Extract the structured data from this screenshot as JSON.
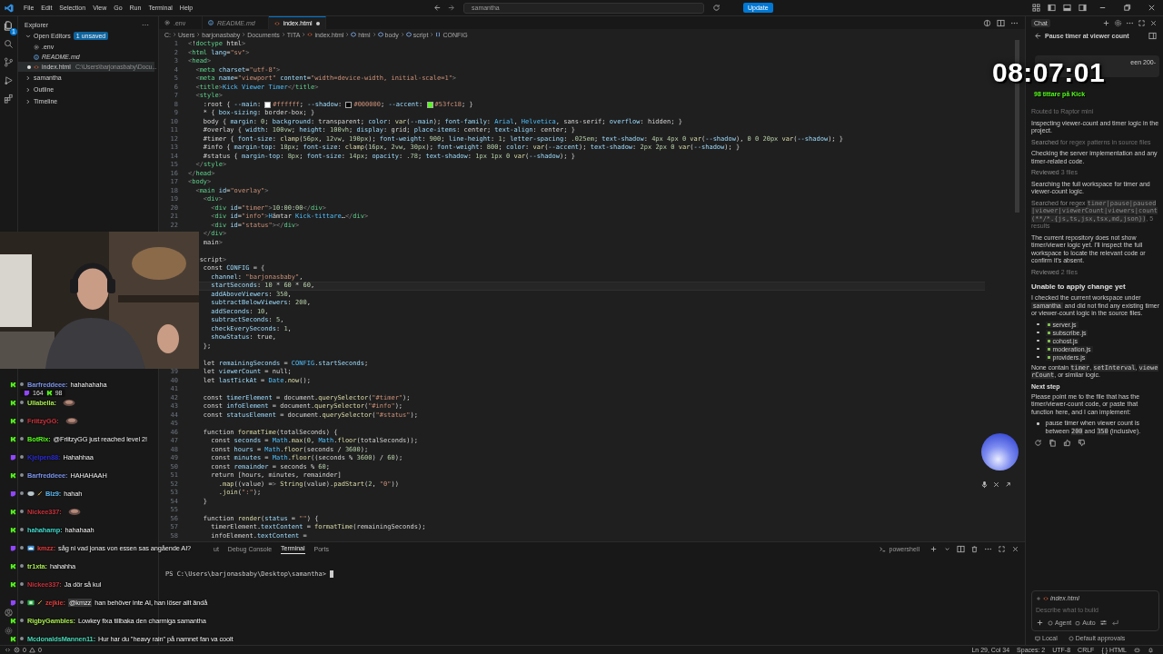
{
  "titlebar": {
    "menu": [
      "File",
      "Edit",
      "Selection",
      "View",
      "Go",
      "Run",
      "Terminal",
      "Help"
    ],
    "search": "samantha",
    "update_button": "Update"
  },
  "activity_bar": {
    "explorer_badge": "1"
  },
  "explorer": {
    "title": "Explorer",
    "open_editors": {
      "label": "Open Editors",
      "badge": "1 unsaved",
      "expanded": true,
      "items": [
        {
          "name": ".env",
          "kind": "settings",
          "preview": false,
          "selected": false,
          "modified": false
        },
        {
          "name": "README.md",
          "kind": "markdown",
          "preview": true,
          "selected": false,
          "modified": false
        },
        {
          "name": "index.html",
          "path": "C:\\Users\\barjonasbaby\\Docu...",
          "kind": "html",
          "preview": false,
          "selected": true,
          "modified": true
        }
      ]
    },
    "sections": [
      {
        "label": "samantha",
        "expanded": false
      },
      {
        "label": "Outline",
        "expanded": false
      },
      {
        "label": "Timeline",
        "expanded": false
      }
    ]
  },
  "tabs": [
    {
      "label": ".env",
      "kind": "settings",
      "preview": false,
      "selected": false,
      "modified": false
    },
    {
      "label": "README.md",
      "kind": "markdown",
      "preview": true,
      "selected": false,
      "modified": false
    },
    {
      "label": "index.html",
      "kind": "html",
      "preview": false,
      "selected": true,
      "modified": true
    }
  ],
  "breadcrumbs": [
    {
      "label": "C:"
    },
    {
      "label": "Users"
    },
    {
      "label": "barjonasbaby"
    },
    {
      "label": "Documents"
    },
    {
      "label": "TITA"
    },
    {
      "label": "index.html",
      "kind": "html"
    },
    {
      "label": "html",
      "kind": "element"
    },
    {
      "label": "body",
      "kind": "element"
    },
    {
      "label": "script",
      "kind": "element"
    },
    {
      "label": "CONFIG",
      "kind": "symbol"
    }
  ],
  "code": {
    "lines": [
      {
        "n": "1",
        "current": false,
        "text": "<!doctype html>"
      },
      {
        "n": "2",
        "current": false,
        "text": "<html lang=\"sv\">"
      },
      {
        "n": "3",
        "current": false,
        "text": "<head>"
      },
      {
        "n": "4",
        "current": false,
        "text": "  <meta charset=\"utf-8\">"
      },
      {
        "n": "5",
        "current": false,
        "text": "  <meta name=\"viewport\" content=\"width=device-width, initial-scale=1\">"
      },
      {
        "n": "6",
        "current": false,
        "text": "  <title>Kick Viewer Timer</title>"
      },
      {
        "n": "7",
        "current": false,
        "text": "  <style>"
      },
      {
        "n": "8",
        "current": false,
        "text": "    :root { --main: #ffffff; --shadow: #000000; --accent: #53fc18; }",
        "swatches": [
          {
            "color": "#ffffff"
          },
          {
            "color": "#000000"
          },
          {
            "color": "#53fc18"
          }
        ]
      },
      {
        "n": "9",
        "current": false,
        "text": "    * { box-sizing: border-box; }"
      },
      {
        "n": "10",
        "current": false,
        "text": "    body { margin: 0; background: transparent; color: var(--main); font-family: Arial, Helvetica, sans-serif; overflow: hidden; }"
      },
      {
        "n": "11",
        "current": false,
        "text": "    #overlay { width: 100vw; height: 100vh; display: grid; place-items: center; text-align: center; }"
      },
      {
        "n": "12",
        "current": false,
        "text": "    #timer { font-size: clamp(56px, 12vw, 190px); font-weight: 900; line-height: 1; letter-spacing: .025em; text-shadow: 4px 4px 0 var(--shadow), 0 0 20px var(--shadow); }"
      },
      {
        "n": "13",
        "current": false,
        "text": "    #info { margin-top: 18px; font-size: clamp(16px, 2vw, 30px); font-weight: 800; color: var(--accent); text-shadow: 2px 2px 0 var(--shadow); }"
      },
      {
        "n": "14",
        "current": false,
        "text": "    #status { margin-top: 8px; font-size: 14px; opacity: .78; text-shadow: 1px 1px 0 var(--shadow); }"
      },
      {
        "n": "15",
        "current": false,
        "text": "  </style>"
      },
      {
        "n": "16",
        "current": false,
        "text": "</head>"
      },
      {
        "n": "17",
        "current": false,
        "text": "<body>"
      },
      {
        "n": "18",
        "current": false,
        "text": "  <main id=\"overlay\">"
      },
      {
        "n": "19",
        "current": false,
        "text": "    <div>"
      },
      {
        "n": "20",
        "current": false,
        "text": "      <div id=\"timer\">10:00:00</div>"
      },
      {
        "n": "21",
        "current": false,
        "text": "      <div id=\"info\">Hämtar Kick-tittare…</div>"
      },
      {
        "n": "22",
        "current": false,
        "text": "      <div id=\"status\"></div>"
      },
      {
        "current": false,
        "text": "    </div>"
      },
      {
        "current": false,
        "text": "    main>"
      },
      {
        "current": false
      },
      {
        "current": false,
        "text": "   script>"
      },
      {
        "current": false,
        "text": "    const CONFIG = {"
      },
      {
        "current": false,
        "text": "      channel: \"barjonasbaby\","
      },
      {
        "current": true,
        "text": "      startSeconds: 10 * 60 * 60,"
      },
      {
        "current": false,
        "text": "      addAboveViewers: 350,"
      },
      {
        "current": false,
        "text": "      subtractBelowViewers: 200,"
      },
      {
        "current": false,
        "text": "      addSeconds: 10,"
      },
      {
        "current": false,
        "text": "      subtractSeconds: 5,"
      },
      {
        "current": false,
        "text": "      checkEverySeconds: 1,"
      },
      {
        "current": false,
        "text": "      showStatus: true,"
      },
      {
        "current": false,
        "text": "    };"
      },
      {
        "current": false
      },
      {
        "current": false,
        "text": "    let remainingSeconds = CONFIG.startSeconds;"
      },
      {
        "n": "39",
        "current": false,
        "text": "    let viewerCount = null;"
      },
      {
        "n": "40",
        "current": false,
        "text": "    let lastTickAt = Date.now();"
      },
      {
        "n": "41",
        "current": false
      },
      {
        "n": "42",
        "current": false,
        "text": "    const timerElement = document.querySelector(\"#timer\");"
      },
      {
        "n": "43",
        "current": false,
        "text": "    const infoElement = document.querySelector(\"#info\");"
      },
      {
        "n": "44",
        "current": false,
        "text": "    const statusElement = document.querySelector(\"#status\");"
      },
      {
        "n": "45",
        "current": false
      },
      {
        "n": "46",
        "current": false,
        "text": "    function formatTime(totalSeconds) {"
      },
      {
        "n": "47",
        "current": false,
        "text": "      const seconds = Math.max(0, Math.floor(totalSeconds));"
      },
      {
        "n": "48",
        "current": false,
        "text": "      const hours = Math.floor(seconds / 3600);"
      },
      {
        "n": "49",
        "current": false,
        "text": "      const minutes = Math.floor((seconds % 3600) / 60);"
      },
      {
        "n": "50",
        "current": false,
        "text": "      const remainder = seconds % 60;"
      },
      {
        "n": "51",
        "current": false,
        "text": "      return [hours, minutes, remainder]"
      },
      {
        "n": "52",
        "current": false,
        "text": "        .map((value) => String(value).padStart(2, \"0\"))"
      },
      {
        "n": "53",
        "current": false,
        "text": "        .join(\":\");"
      },
      {
        "n": "54",
        "current": false,
        "text": "    }"
      },
      {
        "n": "55",
        "current": false
      },
      {
        "n": "56",
        "current": false,
        "text": "    function render(status = \"\") {"
      },
      {
        "n": "57",
        "current": false,
        "text": "      timerElement.textContent = formatTime(remainingSeconds);"
      },
      {
        "n": "58",
        "current": false,
        "text": "      infoElement.textContent ="
      }
    ]
  },
  "panel": {
    "tabs": [
      {
        "label": "ut",
        "selected": false
      },
      {
        "label": "Debug Console",
        "selected": false
      },
      {
        "label": "Terminal",
        "selected": true
      },
      {
        "label": "Ports",
        "selected": false
      }
    ],
    "shell": "powershell",
    "prompt": "PS C:\\Users\\barjonasbaby\\Desktop\\samantha>"
  },
  "status_bar": {
    "errors": "0",
    "warnings": "0",
    "items": [
      "Ln 29, Col 34",
      "Spaces: 2",
      "UTF-8",
      "CRLF",
      "{ } HTML"
    ]
  },
  "chat_panel": {
    "tab": "Chat",
    "title": "Pause timer at viewer count",
    "bubble": "een 200-",
    "blocks": [
      {
        "kind": "note",
        "parts": [
          {
            "kind": "dim",
            "text": "Routed to Raptor mini"
          }
        ]
      },
      {
        "kind": "para",
        "parts": [
          {
            "kind": "plain",
            "text": "Inspecting viewer-count and timer logic in the project."
          }
        ]
      },
      {
        "kind": "note",
        "parts": [
          {
            "kind": "plain",
            "text": "Searched "
          },
          {
            "kind": "dim",
            "text": "for regex patterns in source files"
          }
        ]
      },
      {
        "kind": "para",
        "parts": [
          {
            "kind": "plain",
            "text": "Checking the server implementation and any timer-related code."
          }
        ]
      },
      {
        "kind": "note",
        "parts": [
          {
            "kind": "plain",
            "text": "Reviewed "
          },
          {
            "kind": "dim",
            "text": "3 files"
          }
        ]
      },
      {
        "kind": "para",
        "parts": [
          {
            "kind": "plain",
            "text": "Searching the full workspace for timer and viewer-count logic."
          }
        ]
      },
      {
        "kind": "note",
        "parts": [
          {
            "kind": "plain",
            "text": "Searched for regex "
          },
          {
            "kind": "code",
            "text": "timer|pause|paused|viewer|viewerCount|viewers|count (**/*.{js,ts,jsx,tsx,md,json})"
          },
          {
            "kind": "dim",
            "text": ", 5 results"
          }
        ]
      },
      {
        "kind": "para",
        "parts": [
          {
            "kind": "plain",
            "text": "The current repository does not show timer/viewer logic yet. I'll inspect the full workspace to locate the relevant code or confirm it's absent."
          }
        ]
      },
      {
        "kind": "note",
        "parts": [
          {
            "kind": "plain",
            "text": "Reviewed "
          },
          {
            "kind": "dim",
            "text": "2 files"
          }
        ]
      },
      {
        "kind": "heading",
        "parts": [
          {
            "kind": "plain",
            "text": "Unable to apply change yet"
          }
        ]
      },
      {
        "kind": "para",
        "parts": [
          {
            "kind": "plain",
            "text": "I checked the current workspace under "
          },
          {
            "kind": "folder",
            "text": "samantha"
          },
          {
            "kind": "plain",
            "text": " and did not find any existing timer or viewer-count logic in the source files."
          }
        ]
      },
      {
        "kind": "files",
        "items": [
          "server.js",
          "subscribe.js",
          "cohost.js",
          "moderation.js",
          "providers.js"
        ]
      },
      {
        "kind": "para",
        "parts": [
          {
            "kind": "plain",
            "text": "None contain "
          },
          {
            "kind": "code",
            "text": "timer"
          },
          {
            "kind": "plain",
            "text": ", "
          },
          {
            "kind": "code",
            "text": "setInterval"
          },
          {
            "kind": "plain",
            "text": ", "
          },
          {
            "kind": "code",
            "text": "viewerCount"
          },
          {
            "kind": "plain",
            "text": ", or similar logic."
          }
        ]
      },
      {
        "kind": "subheading",
        "parts": [
          {
            "kind": "plain",
            "text": "Next step"
          }
        ]
      },
      {
        "kind": "para",
        "parts": [
          {
            "kind": "plain",
            "text": "Please point me to the file that has the timer/viewer-count code, or paste that function here, and I can implement:"
          }
        ]
      },
      {
        "kind": "bullet",
        "parts": [
          {
            "kind": "plain",
            "text": "pause timer when viewer count is between "
          },
          {
            "kind": "code",
            "text": "200"
          },
          {
            "kind": "plain",
            "text": " and "
          },
          {
            "kind": "code",
            "text": "350"
          },
          {
            "kind": "plain",
            "text": " (inclusive)."
          }
        ]
      },
      {
        "kind": "actions"
      }
    ],
    "input": {
      "chip": "index.html",
      "placeholder": "Describe what to build",
      "mode": "Agent",
      "model": "Auto"
    },
    "footer": [
      "Local",
      "Default approvals"
    ]
  },
  "stream": {
    "timer": "08:07:01",
    "info": "98 tittare på Kick",
    "viewers": {
      "twitch": "164",
      "kick": "98"
    },
    "chat": [
      {
        "kind": "kick",
        "badges": [
          {
            "kind": "round"
          }
        ],
        "name": "Barfreddeee:",
        "color": "#7b93e8",
        "emote": false,
        "text": "hahahahaha"
      },
      {
        "kind": "kick",
        "badges": [
          {
            "kind": "round"
          }
        ],
        "name": "Ullabella:",
        "color": "#a3e64a",
        "emote": true
      },
      {
        "kind": "kick",
        "badges": [
          {
            "kind": "round"
          }
        ],
        "name": "FriitzyGG:",
        "color": "#c8323c",
        "emote": true
      },
      {
        "kind": "kick",
        "badges": [
          {
            "kind": "round"
          }
        ],
        "name": "BotRix:",
        "color": "#53fc18",
        "emote": false,
        "text": "@FriitzyGG just reached level 2!"
      },
      {
        "kind": "twitch",
        "badges": [
          {
            "kind": "round"
          }
        ],
        "name": "Kjelpen88:",
        "color": "#2b2bd6",
        "emote": false,
        "text": "Hahahhaa"
      },
      {
        "kind": "kick",
        "badges": [
          {
            "kind": "round"
          }
        ],
        "name": "Barfreddeee:",
        "color": "#7b93e8",
        "emote": false,
        "text": "HAHAHAAH"
      },
      {
        "kind": "twitch",
        "badges": [
          {
            "kind": "round"
          },
          {
            "kind": "blob"
          },
          {
            "kind": "sword"
          }
        ],
        "name": "Blz9:",
        "color": "#5fb8ee",
        "emote": false,
        "text": "hahah"
      },
      {
        "kind": "kick",
        "badges": [
          {
            "kind": "round"
          }
        ],
        "name": "Nickee337:",
        "color": "#c8323c",
        "emote": true
      },
      {
        "kind": "kick",
        "badges": [
          {
            "kind": "round"
          }
        ],
        "name": "hahahamp:",
        "color": "#3ed6c8",
        "emote": false,
        "text": "hahahaah"
      },
      {
        "kind": "twitch",
        "badges": [
          {
            "kind": "round"
          },
          {
            "kind": "crown"
          }
        ],
        "name": "kmzz:",
        "color": "#e23b3b",
        "emote": false,
        "text": "såg ni vad jonas von essen sas angående AI?"
      },
      {
        "kind": "kick",
        "badges": [
          {
            "kind": "round"
          }
        ],
        "name": "tr1xta:",
        "color": "#a3e64a",
        "emote": false,
        "text": "hahahha"
      },
      {
        "kind": "kick",
        "badges": [
          {
            "kind": "round"
          }
        ],
        "name": "Nickee337:",
        "color": "#c8323c",
        "emote": false,
        "text": "Ja dör så kul"
      },
      {
        "kind": "twitch",
        "badges": [
          {
            "kind": "round"
          },
          {
            "kind": "gift"
          },
          {
            "kind": "sword"
          }
        ],
        "name": "zejkie:",
        "color": "#e23b3b",
        "emote": false,
        "mention": "@kmzz",
        "text": "han behöver inte AI, han löser allt ändå"
      },
      {
        "kind": "kick",
        "badges": [
          {
            "kind": "round"
          }
        ],
        "name": "RigbyGambles:",
        "color": "#a3e64a",
        "emote": false,
        "text": "Lowkey fixa tillbaka den charmiga samantha"
      },
      {
        "kind": "kick",
        "badges": [
          {
            "kind": "round"
          }
        ],
        "name": "McdonaldsMannen11:",
        "color": "#45d6b5",
        "emote": false,
        "text": "Hur har du \"heavy rain\" på namnet fan va coolt"
      }
    ]
  }
}
